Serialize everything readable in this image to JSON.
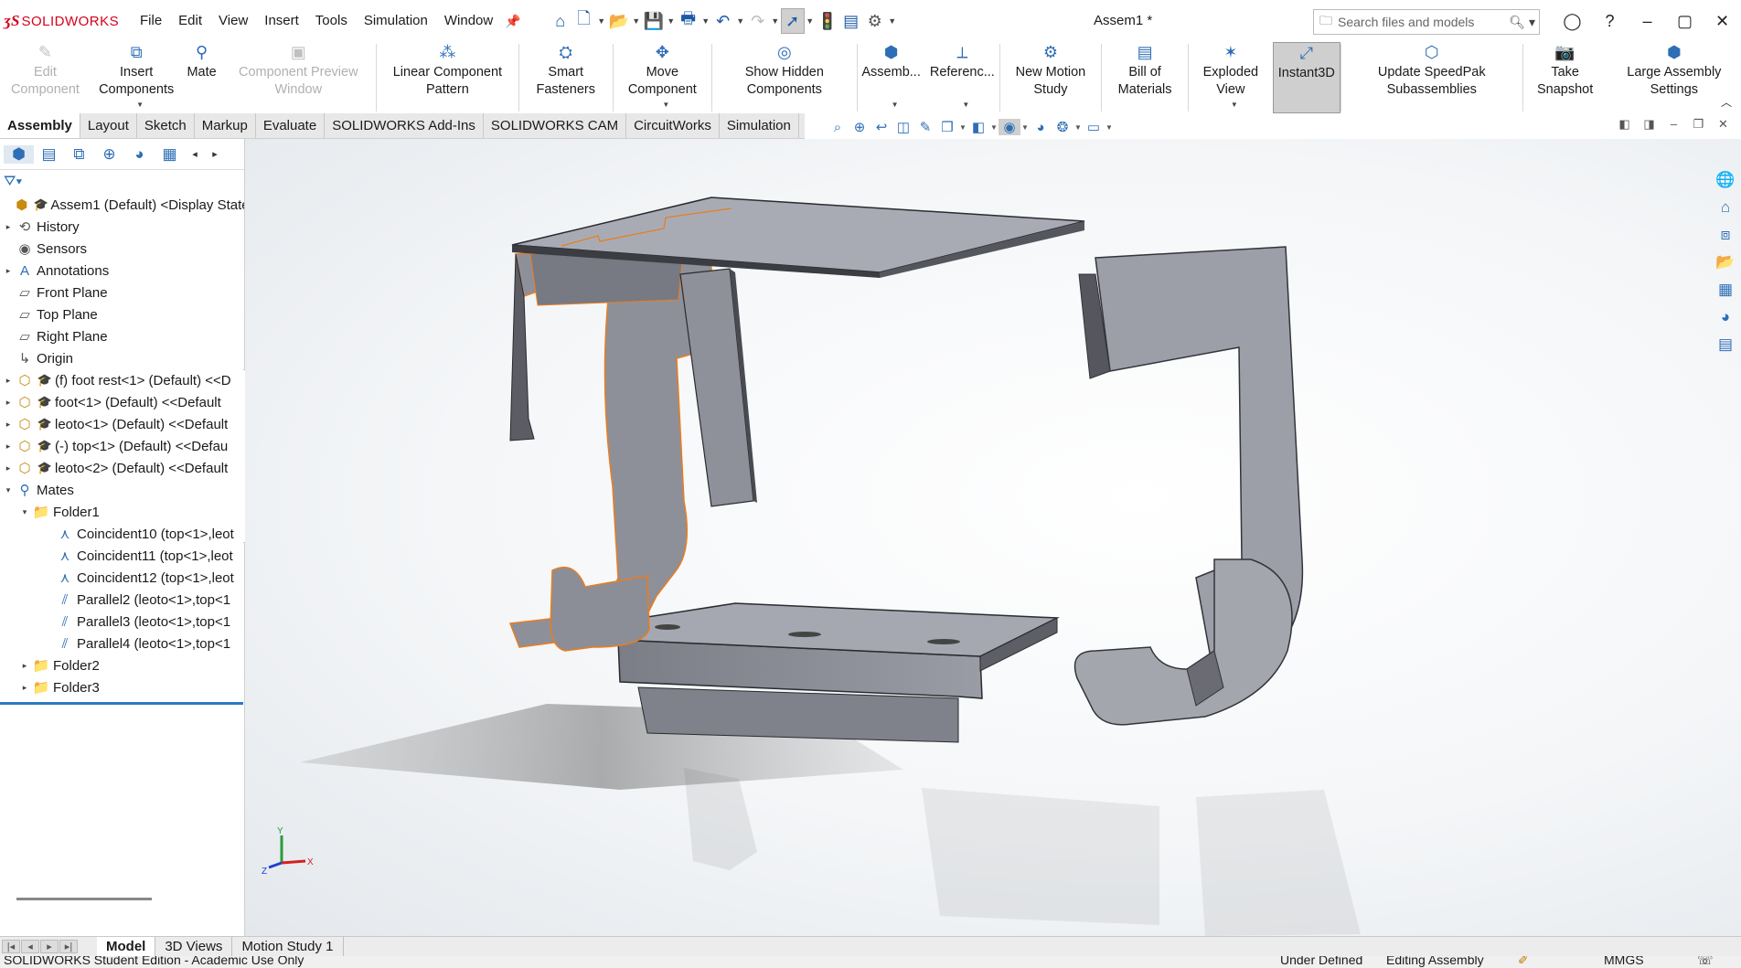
{
  "app": {
    "brand": "SOLIDWORKS",
    "brand_prefix": "3S",
    "document_title": "Assem1 *"
  },
  "menu": [
    "File",
    "Edit",
    "View",
    "Insert",
    "Tools",
    "Simulation",
    "Window"
  ],
  "search": {
    "placeholder": "Search files and models"
  },
  "ribbon": [
    {
      "label": "Edit Component",
      "icon": "edit-component-icon",
      "disabled": true
    },
    {
      "label": "Insert Components",
      "icon": "insert-components-icon",
      "disabled": false
    },
    {
      "label": "Mate",
      "icon": "mate-icon",
      "disabled": false
    },
    {
      "label": "Component Preview Window",
      "icon": "preview-window-icon",
      "disabled": true
    },
    {
      "label": "Linear Component Pattern",
      "icon": "pattern-icon",
      "disabled": false
    },
    {
      "label": "Smart Fasteners",
      "icon": "fastener-icon",
      "disabled": false
    },
    {
      "label": "Move Component",
      "icon": "move-icon",
      "disabled": false
    },
    {
      "label": "Show Hidden Components",
      "icon": "show-hidden-icon",
      "disabled": false
    },
    {
      "label": "Assemb...",
      "icon": "assembly-features-icon",
      "disabled": false
    },
    {
      "label": "Referenc...",
      "icon": "reference-geometry-icon",
      "disabled": false
    },
    {
      "label": "New Motion Study",
      "icon": "motion-study-icon",
      "disabled": false
    },
    {
      "label": "Bill of Materials",
      "icon": "bom-icon",
      "disabled": false
    },
    {
      "label": "Exploded View",
      "icon": "exploded-view-icon",
      "disabled": false
    },
    {
      "label": "Instant3D",
      "icon": "instant3d-icon",
      "disabled": false,
      "active": true
    },
    {
      "label": "Update SpeedPak Subassemblies",
      "icon": "speedpak-icon",
      "disabled": false
    },
    {
      "label": "Take Snapshot",
      "icon": "camera-icon",
      "disabled": false
    },
    {
      "label": "Large Assembly Settings",
      "icon": "large-assembly-icon",
      "disabled": false
    }
  ],
  "tabs": [
    "Assembly",
    "Layout",
    "Sketch",
    "Markup",
    "Evaluate",
    "SOLIDWORKS Add-Ins",
    "SOLIDWORKS CAM",
    "CircuitWorks",
    "Simulation"
  ],
  "active_tab": "Assembly",
  "tree": [
    {
      "label": "Assem1 (Default) <Display State-",
      "icon": "assembly-icon",
      "indent": 0,
      "expander": ""
    },
    {
      "label": "History",
      "icon": "history-icon",
      "indent": 1,
      "expander": "▸"
    },
    {
      "label": "Sensors",
      "icon": "sensors-icon",
      "indent": 1,
      "expander": ""
    },
    {
      "label": "Annotations",
      "icon": "annotations-icon",
      "indent": 1,
      "expander": "▸"
    },
    {
      "label": "Front Plane",
      "icon": "plane-icon",
      "indent": 1,
      "expander": ""
    },
    {
      "label": "Top Plane",
      "icon": "plane-icon",
      "indent": 1,
      "expander": ""
    },
    {
      "label": "Right Plane",
      "icon": "plane-icon",
      "indent": 1,
      "expander": ""
    },
    {
      "label": "Origin",
      "icon": "origin-icon",
      "indent": 1,
      "expander": ""
    },
    {
      "label": "(f) foot rest<1> (Default) <<D",
      "icon": "part-icon",
      "indent": 1,
      "expander": "▸"
    },
    {
      "label": "foot<1> (Default) <<Default",
      "icon": "part-icon",
      "indent": 1,
      "expander": "▸"
    },
    {
      "label": "leoto<1> (Default) <<Default",
      "icon": "part-icon",
      "indent": 1,
      "expander": "▸"
    },
    {
      "label": "(-) top<1> (Default) <<Defau",
      "icon": "part-icon",
      "indent": 1,
      "expander": "▸"
    },
    {
      "label": "leoto<2> (Default) <<Default",
      "icon": "part-icon",
      "indent": 1,
      "expander": "▸"
    },
    {
      "label": "Mates",
      "icon": "mates-icon",
      "indent": 1,
      "expander": "▾"
    },
    {
      "label": "Folder1",
      "icon": "folder-icon",
      "indent": 2,
      "expander": "▾"
    },
    {
      "label": "Coincident10 (top<1>,leot",
      "icon": "coincident-icon",
      "indent": 3,
      "expander": ""
    },
    {
      "label": "Coincident11 (top<1>,leot",
      "icon": "coincident-icon",
      "indent": 3,
      "expander": ""
    },
    {
      "label": "Coincident12 (top<1>,leot",
      "icon": "coincident-icon",
      "indent": 3,
      "expander": ""
    },
    {
      "label": "Parallel2 (leoto<1>,top<1",
      "icon": "parallel-icon",
      "indent": 3,
      "expander": ""
    },
    {
      "label": "Parallel3 (leoto<1>,top<1",
      "icon": "parallel-icon",
      "indent": 3,
      "expander": ""
    },
    {
      "label": "Parallel4 (leoto<1>,top<1",
      "icon": "parallel-icon",
      "indent": 3,
      "expander": ""
    },
    {
      "label": "Folder2",
      "icon": "folder-icon",
      "indent": 2,
      "expander": "▸"
    },
    {
      "label": "Folder3",
      "icon": "folder-icon",
      "indent": 2,
      "expander": "▸"
    }
  ],
  "triad": {
    "x": "X",
    "y": "Y",
    "z": "Z"
  },
  "bottom_tabs": [
    "Model",
    "3D Views",
    "Motion Study 1"
  ],
  "status": {
    "left": "SOLIDWORKS Student Edition - Academic Use Only",
    "state": "Under Defined",
    "mode": "Editing Assembly",
    "units": "MMGS"
  },
  "colors": {
    "brand_red": "#d6001c",
    "selection_orange": "#e87d1f",
    "part_grey": "#8a8b94",
    "tree_accent": "#2b79c9"
  }
}
